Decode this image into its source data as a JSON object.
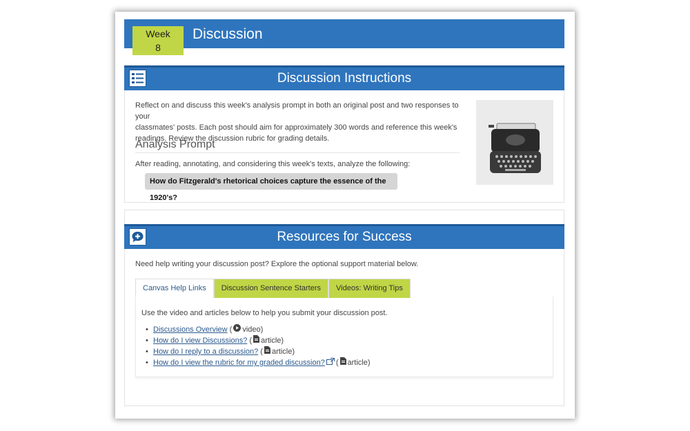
{
  "header": {
    "week_label": "Week",
    "week_number": "8",
    "title": "Discussion"
  },
  "instructions": {
    "title": "Discussion Instructions",
    "intro_lines": [
      "Reflect on and discuss this week's analysis prompt in both an original post and two responses to your",
      "classmates' posts. Each post should aim for approximately 300 words and reference this week's",
      "readings. Review the discussion rubric for grading details."
    ],
    "prompt_heading": "Analysis Prompt",
    "prompt_text": "After reading, annotating, and considering this week's texts, analyze the following:",
    "question": "How do Fitzgerald's rhetorical choices capture the essence of the 1920's?",
    "icon": "list-icon",
    "image": "typewriter-photo"
  },
  "resources": {
    "title": "Resources for Success",
    "icon": "chat-plus-icon",
    "intro": "Need help writing your discussion post? Explore the optional support material below.",
    "tabs": [
      {
        "label": "Canvas Help Links",
        "active": true
      },
      {
        "label": "Discussion Sentence Starters",
        "active": false
      },
      {
        "label": "Videos: Writing Tips",
        "active": false
      }
    ],
    "tab_intro": "Use the video and articles below to help you submit your discussion post.",
    "links": [
      {
        "text": "Discussions Overview",
        "kind_icon": "play-icon",
        "kind": "video)"
      },
      {
        "text": "How do I view Discussions?",
        "kind_icon": "document-icon",
        "kind": "article)"
      },
      {
        "text": "How do I reply to a discussion?",
        "kind_icon": "document-icon",
        "kind": "article)"
      },
      {
        "text": "How do I view the rubric for my graded discussion?",
        "kind_icon": "document-icon",
        "kind": "article)",
        "external": true
      }
    ]
  },
  "colors": {
    "blue": "#2f75bd",
    "green": "#c0d646",
    "link": "#2c5a8e"
  }
}
